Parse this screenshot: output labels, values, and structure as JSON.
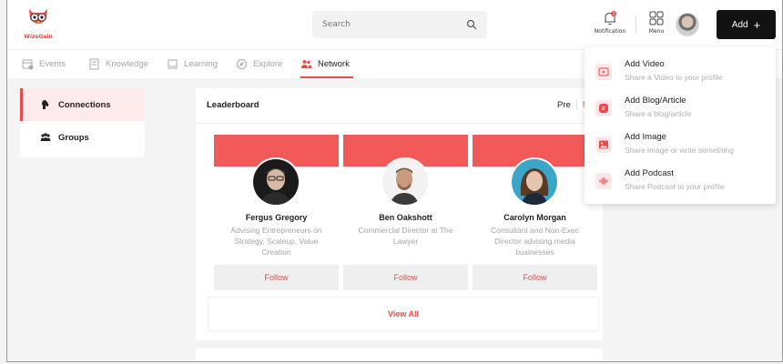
{
  "header": {
    "logo_text": "WizeGain",
    "search_placeholder": "Search",
    "notification_label": "Notification",
    "notification_count": "3",
    "menu_label": "Menu",
    "add_label": "Add",
    "add_symbol": "+"
  },
  "tabs": [
    {
      "label": "Events",
      "icon": "calendar-icon"
    },
    {
      "label": "Knowledge",
      "icon": "knowledge-icon"
    },
    {
      "label": "Learning",
      "icon": "learning-icon"
    },
    {
      "label": "Explore",
      "icon": "compass-icon"
    },
    {
      "label": "Network",
      "icon": "network-icon",
      "active": true
    }
  ],
  "sidebar": {
    "items": [
      {
        "label": "Connections",
        "active": true,
        "icon": "connections-icon"
      },
      {
        "label": "Groups",
        "active": false,
        "icon": "groups-icon"
      }
    ]
  },
  "leaderboard": {
    "title": "Leaderboard",
    "prev_label": "Pre",
    "next_label": "Ne",
    "view_all_label": "View All",
    "cards": [
      {
        "name": "Fergus Gregory",
        "desc": "Advising Entrepreneurs on Strategy, Scaleup, Value Creation",
        "follow": "Follow"
      },
      {
        "name": "Ben Oakshott",
        "desc": "Commercial Director at The Lawyer",
        "follow": "Follow"
      },
      {
        "name": "Carolyn Morgan",
        "desc": "Consultant and Non-Exec Director advising media businesses",
        "follow": "Follow"
      }
    ]
  },
  "add_menu": {
    "items": [
      {
        "title": "Add Video",
        "subtitle": "Share a Video to your profile",
        "icon": "video-icon"
      },
      {
        "title": "Add Blog/Article",
        "subtitle": "Share a blog/article",
        "icon": "blog-icon"
      },
      {
        "title": "Add Image",
        "subtitle": "Share image or write something",
        "icon": "image-icon"
      },
      {
        "title": "Add Podcast",
        "subtitle": "Share Podcast to your profile",
        "icon": "podcast-icon"
      }
    ]
  },
  "colors": {
    "accent": "#e84b4b",
    "dark_button": "#121212"
  }
}
